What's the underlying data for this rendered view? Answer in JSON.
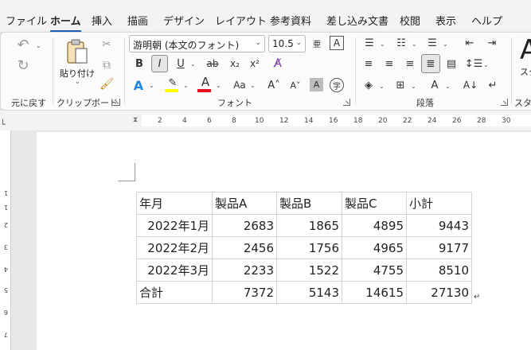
{
  "menu": {
    "tabs": [
      "ファイル",
      "ホーム",
      "挿入",
      "描画",
      "デザイン",
      "レイアウト",
      "参考資料",
      "差し込み文書",
      "校閲",
      "表示",
      "ヘルプ"
    ],
    "active": "ホーム"
  },
  "ribbon": {
    "undo": {
      "group_label": "元に戻す"
    },
    "clipboard": {
      "paste_label": "貼り付け",
      "group_label": "クリップボード"
    },
    "font": {
      "font_name": "游明朝 (本文のフォント)",
      "font_size": "10.5",
      "group_label": "フォント",
      "highlight_color": "#ffff00",
      "font_color": "#e81123"
    },
    "paragraph": {
      "group_label": "段落"
    },
    "styles": {
      "group_label": "スタイ",
      "style_letter": "A",
      "style_name": "スタ"
    }
  },
  "ruler": {
    "top_ticks": [
      "2",
      "4",
      "6",
      "8",
      "10",
      "12",
      "14",
      "16",
      "18",
      "20",
      "22",
      "24",
      "26",
      "28",
      "30"
    ],
    "left_ticks": [
      "1",
      "1",
      "2",
      "3",
      "4",
      "5",
      "6",
      "7"
    ]
  },
  "table": {
    "headers": [
      "年月",
      "製品A",
      "製品B",
      "製品C",
      "小計"
    ],
    "rows": [
      [
        "2022年1月",
        "2683",
        "1865",
        "4895",
        "9443"
      ],
      [
        "2022年2月",
        "2456",
        "1756",
        "4965",
        "9177"
      ],
      [
        "2022年3月",
        "2233",
        "1522",
        "4755",
        "8510"
      ]
    ],
    "total": [
      "合計",
      "7372",
      "5143",
      "14615",
      "27130"
    ]
  }
}
